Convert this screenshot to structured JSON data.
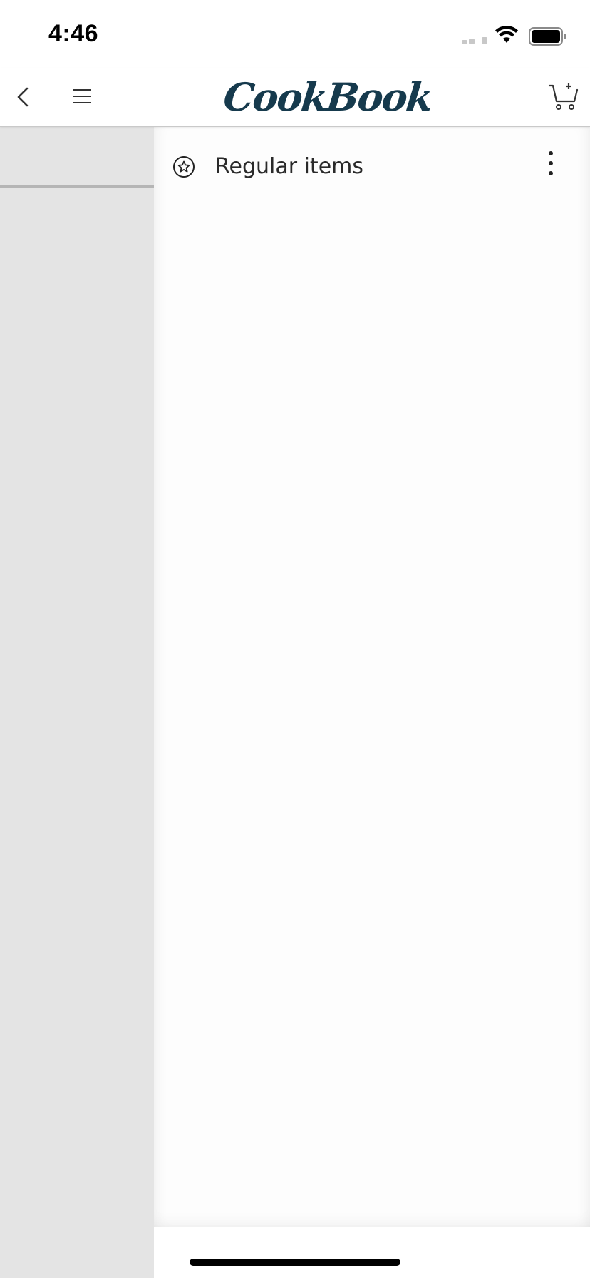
{
  "status_bar": {
    "time": "4:46"
  },
  "header": {
    "logo_text": "CookBook",
    "back_icon": "chevron-left-icon",
    "menu_icon": "hamburger-menu-icon",
    "cart_icon": "add-to-cart-icon"
  },
  "drawer": {
    "items": [
      {
        "label": "Regular items",
        "icon": "star-circle-icon"
      }
    ]
  },
  "colors": {
    "brand": "#163a4d",
    "dim_panel": "#e4e4e4",
    "drawer_bg": "#fdfdfd"
  }
}
